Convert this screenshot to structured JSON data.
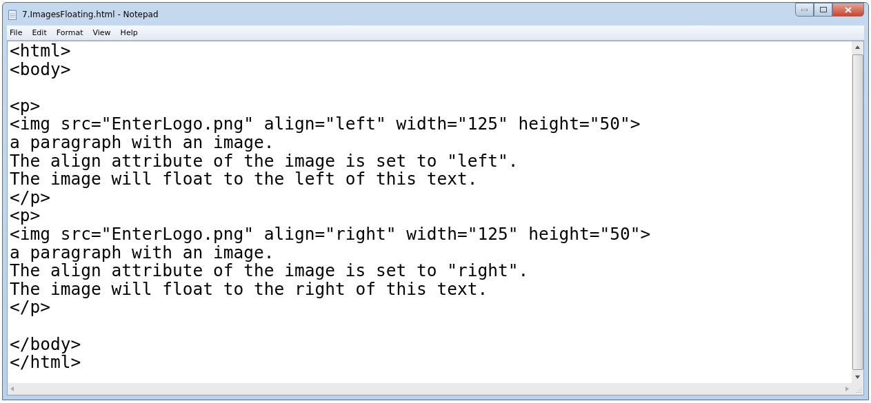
{
  "window": {
    "title": "7.ImagesFloating.html - Notepad"
  },
  "menu": [
    "File",
    "Edit",
    "Format",
    "View",
    "Help"
  ],
  "editor": {
    "blocks": [
      [
        "<html>",
        "<body>"
      ],
      [
        "<p>",
        "<img src=\"EnterLogo.png\" align=\"left\" width=\"125\" height=\"50\">",
        "a paragraph with an image.",
        "The align attribute of the image is set to \"left\".",
        "The image will float to the left of this text.",
        "</p>",
        "<p>",
        "<img src=\"EnterLogo.png\" align=\"right\" width=\"125\" height=\"50\">",
        "a paragraph with an image.",
        "The align attribute of the image is set to \"right\".",
        "The image will float to the right of this text.",
        "</p>"
      ],
      [
        "</body>",
        "</html>"
      ]
    ]
  }
}
